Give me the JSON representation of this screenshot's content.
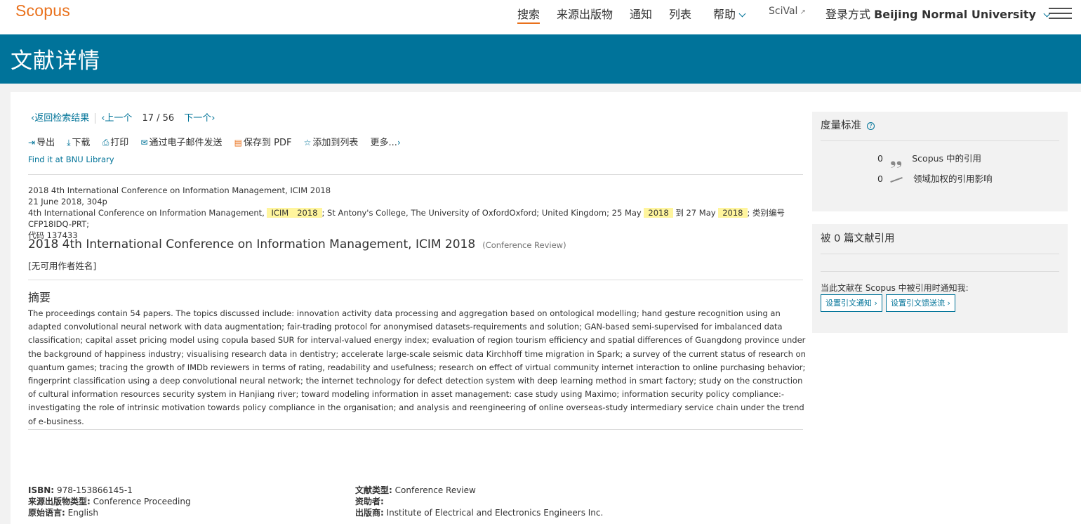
{
  "header": {
    "logo": "Scopus",
    "nav": {
      "search": "搜索",
      "sources": "来源出版物",
      "alerts": "通知",
      "lists": "列表",
      "help": "帮助",
      "scival": "SciVal",
      "login_prefix": "登录方式",
      "institution": "Beijing Normal University"
    }
  },
  "banner": {
    "title": "文献详情"
  },
  "navigation": {
    "back": "返回检索结果",
    "prev": "上一个",
    "current": "17",
    "slash": "/",
    "total": "56",
    "next": "下一个"
  },
  "toolbar": {
    "export": "导出",
    "download": "下载",
    "print": "打印",
    "email": "通过电子邮件发送",
    "pdf": "保存到 PDF",
    "add_list": "添加到列表",
    "more": "更多..."
  },
  "findit": "Find it at BNU Library",
  "meta": {
    "line1": "2018 4th International Conference on Information Management, ICIM 2018",
    "line2": "21 June 2018, 304p",
    "line3_a": "4th International Conference on Information Management,",
    "hl_icim": "ICIM",
    "hl_2018a": "2018",
    "line3_b": "; St Antony's College, The University of OxfordOxford; United Kingdom; 25 May",
    "hl_2018b": "2018",
    "line3_c": "到 27 May",
    "hl_2018c": "2018",
    "line3_d": "; 类别编号CFP18IDQ-PRT;",
    "line4": "代码 137433"
  },
  "document": {
    "title": "2018 4th International Conference on Information Management, ICIM 2018",
    "type": "(Conference Review)",
    "authors": "[无可用作者姓名]"
  },
  "abstract": {
    "heading": "摘要",
    "text": "The proceedings contain 54 papers. The topics discussed include: innovation activity data processing and aggregation based on ontological modelling; hand gesture recognition using an adapted convolutional neural network with data augmentation; fair-trading protocol for anonymised datasets-requirements and solution; GAN-based semi-supervised for imbalanced data classification; capital asset pricing model using copula based SUR for interval-valued energy index; evaluation of region tourism efficiency and spatial differences of Guangdong province under the background of happiness industry; visualising research data in dentistry; accelerate large-scale seismic data Kirchhoff time migration in Spark; a survey of the current status of research on quantum games; tracing the growth of IMDb reviewers in terms of rating, readability and usefulness; research on effect of virtual community internet interaction to online purchasing behavior; fingerprint classification using a deep convolutional neural network; the internet technology for defect detection system with deep learning method in smart factory; study on the construction of cultural information resources security system in Hanjiang river; toward modeling information in asset management: case study using Maximo; information security policy compliance:-investigating the role of intrinsic motivation towards policy compliance in the organisation; and analysis and reengineering of online overseas-study intermediary service chain under the trend of e-business."
  },
  "details": {
    "isbn_label": "ISBN:",
    "isbn": "978-153866145-1",
    "source_type_label": "来源出版物类型:",
    "source_type": "Conference Proceeding",
    "language_label": "原始语言:",
    "language": "English",
    "doc_type_label": "文献类型:",
    "doc_type": "Conference Review",
    "sponsor_label": "资助者:",
    "sponsor": "",
    "publisher_label": "出版商:",
    "publisher": "Institute of Electrical and Electronics Engineers Inc."
  },
  "metrics": {
    "heading": "度量标准",
    "help": "?",
    "citations_value": "0",
    "citations_label": "Scopus 中的引用",
    "fwci_value": "0",
    "fwci_label": "领域加权的引用影响"
  },
  "cited_by": {
    "heading": "被 0 篇文献引用",
    "notify_text": "当此文献在 Scopus 中被引用时通知我:",
    "alert_button": "设置引文通知 ›",
    "feed_button": "设置引文馈送流 ›"
  },
  "colors": {
    "accent": "#e9711c",
    "brand": "#00739a",
    "link": "#007398",
    "highlight": "#fff59d"
  }
}
